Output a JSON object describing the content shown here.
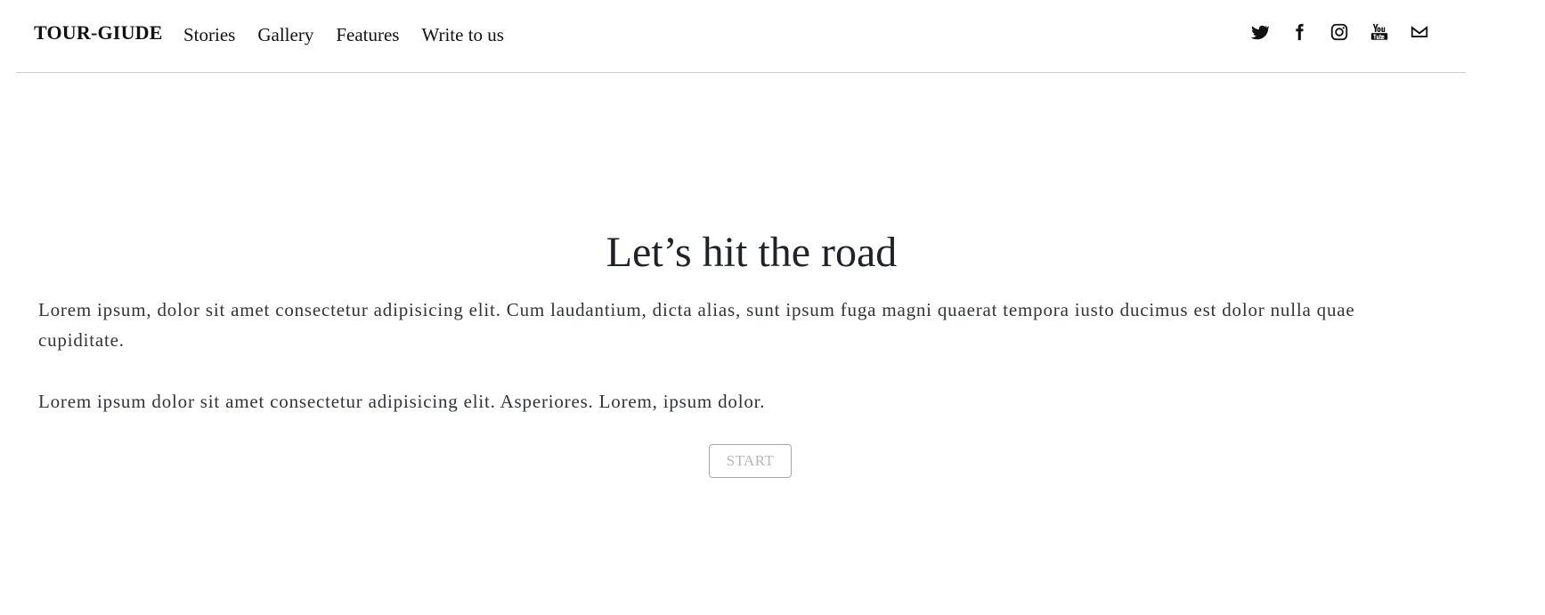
{
  "navbar": {
    "brand": "TOUR-GIUDE",
    "links": [
      {
        "label": "Stories"
      },
      {
        "label": "Gallery"
      },
      {
        "label": "Features"
      },
      {
        "label": "Write to us"
      }
    ],
    "social_icons": [
      {
        "name": "twitter-icon"
      },
      {
        "name": "facebook-icon"
      },
      {
        "name": "instagram-icon"
      },
      {
        "name": "youtube-icon"
      },
      {
        "name": "mail-icon"
      }
    ]
  },
  "hero": {
    "title": "Let’s hit the road",
    "paragraphs": [
      "Lorem ipsum, dolor sit amet consectetur adipisicing elit. Cum laudantium, dicta alias, sunt ipsum fuga magni quaerat tempora iusto ducimus est dolor nulla quae cupiditate.",
      "Lorem ipsum dolor sit amet consectetur adipisicing elit. Asperiores. Lorem, ipsum dolor."
    ],
    "button_label": "START"
  },
  "colors": {
    "text": "#212529",
    "divider": "#cfcfcf",
    "button_border": "#a8a8a8",
    "button_text": "#b7b7b7"
  }
}
